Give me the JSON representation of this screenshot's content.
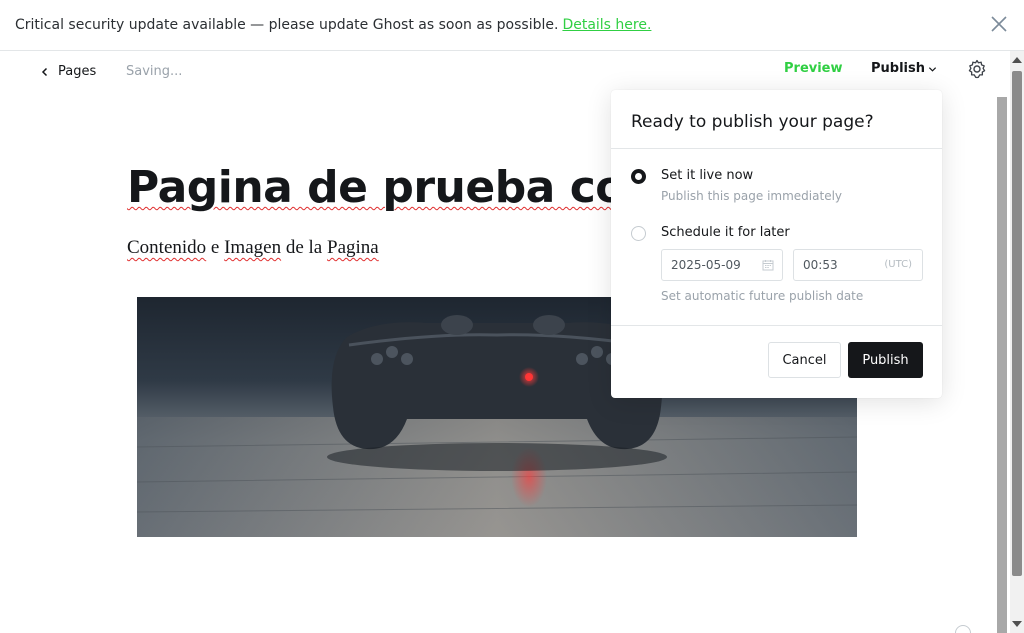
{
  "banner": {
    "message": "Critical security update available — please update Ghost as soon as possible.",
    "link_label": "Details here.",
    "link_color": "#30cf43"
  },
  "header": {
    "back_label": "Pages",
    "status": "Saving...",
    "preview_label": "Preview",
    "publish_label": "Publish"
  },
  "editor": {
    "title": "Pagina de prueba con",
    "body_words": [
      "Contenido",
      "e",
      "Imagen",
      "de",
      "la",
      "Pagina"
    ]
  },
  "publish_menu": {
    "title": "Ready to publish your page?",
    "option_now": {
      "label": "Set it live now",
      "description": "Publish this page immediately",
      "selected": true
    },
    "option_schedule": {
      "label": "Schedule it for later",
      "date": "2025-05-09",
      "time": "00:53",
      "timezone": "(UTC)",
      "hint": "Set automatic future publish date",
      "selected": false
    },
    "cancel_label": "Cancel",
    "publish_label": "Publish"
  },
  "icons": {
    "close": "close-icon",
    "back": "chevron-left-icon",
    "dropdown": "chevron-down-icon",
    "settings": "gear-icon",
    "calendar": "calendar-icon"
  },
  "colors": {
    "accent": "#30cf43",
    "primary_button": "#15171a"
  }
}
